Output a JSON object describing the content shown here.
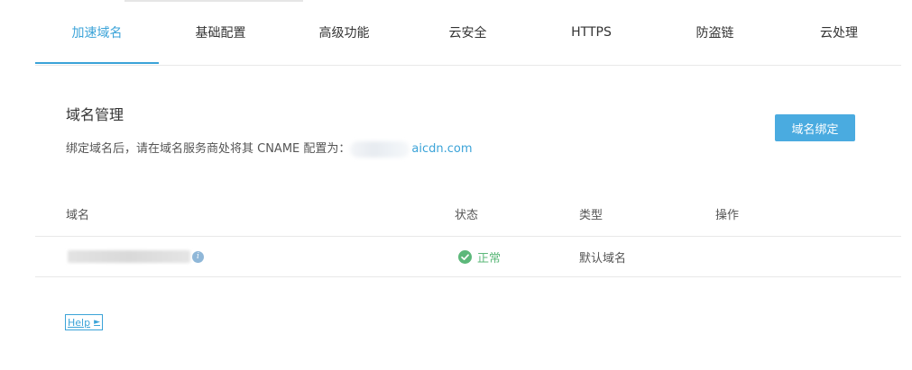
{
  "tabs": [
    {
      "label": "加速域名"
    },
    {
      "label": "基础配置"
    },
    {
      "label": "高级功能"
    },
    {
      "label": "云安全"
    },
    {
      "label": "HTTPS"
    },
    {
      "label": "防盗链"
    },
    {
      "label": "云处理"
    }
  ],
  "domain_section": {
    "title": "域名管理",
    "hint": "绑定域名后，请在域名服务商处将其 CNAME 配置为：",
    "cname_suffix": "aicdn.com",
    "bind_button": "域名绑定"
  },
  "table": {
    "headers": [
      "域名",
      "状态",
      "类型",
      "操作"
    ],
    "rows": [
      {
        "status": "正常",
        "type": "默认域名",
        "info_icon": "info-icon"
      }
    ]
  },
  "help": {
    "label": "Help",
    "arrow": "►"
  },
  "colors": {
    "accent": "#3ba3d8",
    "button": "#4aabe0",
    "success": "#5cb87a"
  }
}
